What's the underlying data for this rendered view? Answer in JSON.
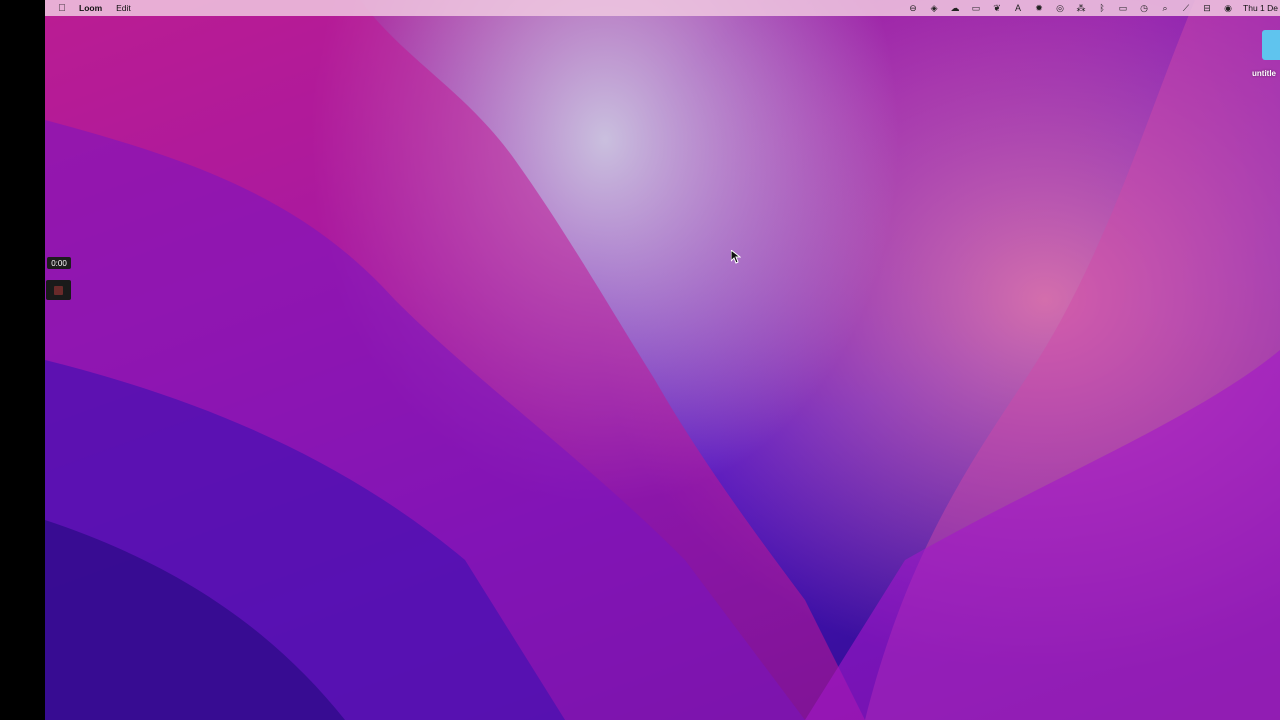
{
  "menubar": {
    "app_name": "Loom",
    "menus": [
      "Edit"
    ],
    "status_icons": [
      "minus-circle-icon",
      "dropbox-icon",
      "creative-cloud-icon",
      "screen-share-icon",
      "evernote-icon",
      "font-app-icon",
      "gear-icon",
      "play-icon",
      "fan-icon",
      "bluetooth-icon",
      "battery-icon",
      "time-machine-icon",
      "search-icon",
      "wifi-off-icon",
      "control-center-icon",
      "siri-icon"
    ],
    "clock": "Thu 1 De"
  },
  "loom": {
    "timer": "0:00"
  },
  "desktop": {
    "folder_label": "untitle"
  },
  "colors": {
    "menubar_bg": "#f0c8e1",
    "folder": "#5fc4ee",
    "stop": "#6a2a2a"
  }
}
